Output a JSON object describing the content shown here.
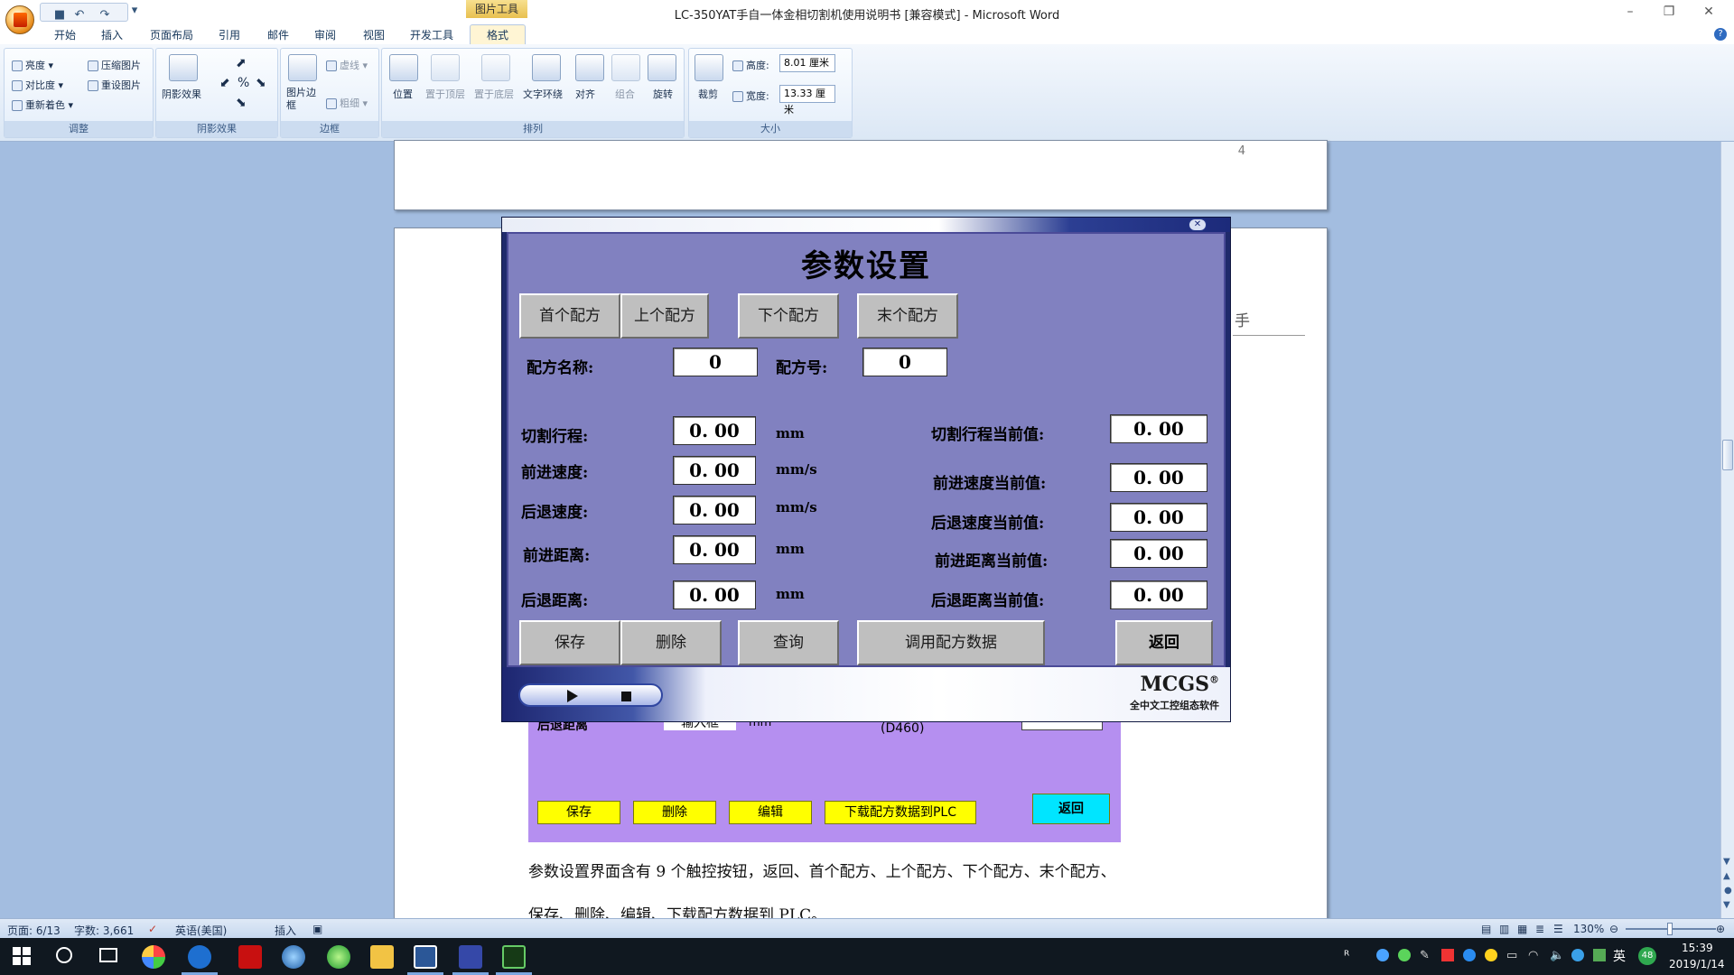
{
  "window": {
    "title": "LC-350YAT手自一体金相切割机使用说明书 [兼容模式] - Microsoft Word",
    "contextual_tab_group": "图片工具"
  },
  "ribbon_tabs": [
    "开始",
    "插入",
    "页面布局",
    "引用",
    "邮件",
    "审阅",
    "视图",
    "开发工具",
    "格式"
  ],
  "active_tab": "格式",
  "ribbon": {
    "adjust": {
      "brightness": "亮度",
      "contrast": "对比度",
      "recolor": "重新着色",
      "compress": "压缩图片",
      "reset": "重设图片",
      "label": "调整"
    },
    "shadow": {
      "effects": "阴影效果",
      "label": "阴影效果"
    },
    "border": {
      "picture_border": "图片边框",
      "dashes": "虚线",
      "weight": "粗细",
      "label": "边框"
    },
    "arrange": {
      "position": "位置",
      "bring_front": "置于顶层",
      "send_back": "置于底层",
      "wrap": "文字环绕",
      "align": "对齐",
      "group": "组合",
      "rotate": "旋转",
      "label": "排列"
    },
    "size": {
      "crop": "裁剪",
      "height_label": "高度:",
      "height_value": "8.01 厘米",
      "width_label": "宽度:",
      "width_value": "13.33 厘米",
      "label": "大小"
    }
  },
  "doc": {
    "page_number": "4",
    "header_fragment": "手",
    "underlay": {
      "label_back_distance": "后退距离",
      "input_placeholder": "输入框",
      "unit": "mm",
      "register": "(D460)",
      "buttons": [
        "保存",
        "删除",
        "编辑",
        "下载配方数据到PLC"
      ],
      "return": "返回"
    },
    "para1": "参数设置界面含有 9 个触控按钮，返回、首个配方、上个配方、下个配方、末个配方、",
    "para2": "保存、删除、编辑、下载配方数据到 PLC。"
  },
  "mcgs": {
    "title": "参数设置",
    "nav_buttons": [
      "首个配方",
      "上个配方",
      "下个配方",
      "末个配方"
    ],
    "recipe_name_label": "配方名称:",
    "recipe_name_value": "0",
    "recipe_no_label": "配方号:",
    "recipe_no_value": "0",
    "params": [
      {
        "label": "切割行程:",
        "value": "0. 00",
        "unit": "mm",
        "current_label": "切割行程当前值:",
        "current_value": "0. 00"
      },
      {
        "label": "前进速度:",
        "value": "0. 00",
        "unit": "mm/s",
        "current_label": "前进速度当前值:",
        "current_value": "0. 00"
      },
      {
        "label": "后退速度:",
        "value": "0. 00",
        "unit": "mm/s",
        "current_label": "后退速度当前值:",
        "current_value": "0. 00"
      },
      {
        "label": "前进距离:",
        "value": "0. 00",
        "unit": "mm",
        "current_label": "前进距离当前值:",
        "current_value": "0. 00"
      },
      {
        "label": "后退距离:",
        "value": "0. 00",
        "unit": "mm",
        "current_label": "后退距离当前值:",
        "current_value": "0. 00"
      }
    ],
    "action_buttons": [
      "保存",
      "删除",
      "查询",
      "调用配方数据"
    ],
    "return_button": "返回",
    "brand": "MCGS",
    "brand_mark": "®",
    "brand_sub": "全中文工控组态软件"
  },
  "status": {
    "page": "页面: 6/13",
    "words": "字数: 3,661",
    "language": "英语(美国)",
    "mode": "插入",
    "zoom": "130%"
  },
  "taskbar": {
    "ime": "英",
    "badge": "48",
    "time": "15:39",
    "date": "2019/1/14"
  },
  "colors": {
    "mcgs_screen": "#8181c0",
    "underlay": "#b58ff0",
    "yellow_button": "#ffff00",
    "return_button": "#00e5ff"
  }
}
